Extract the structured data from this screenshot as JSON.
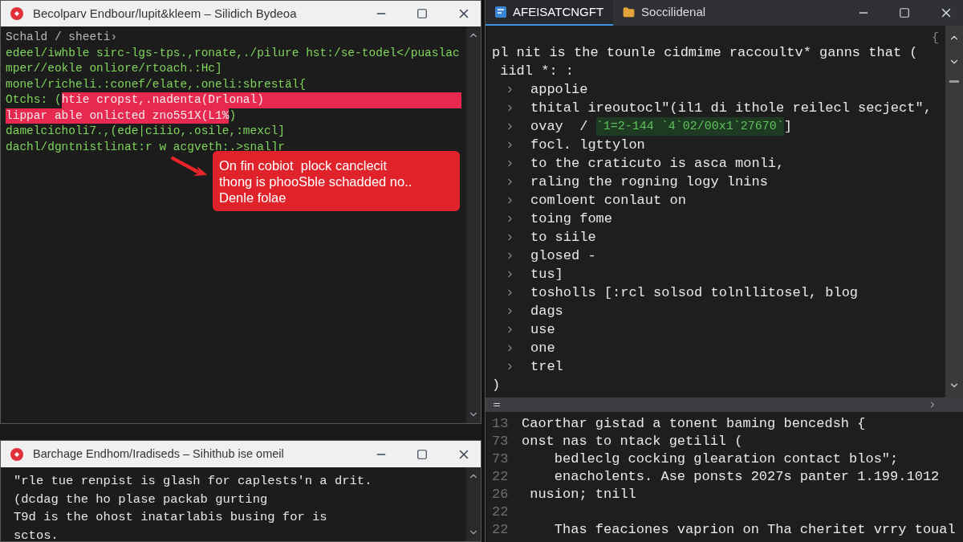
{
  "terminal_window": {
    "title": "Becolparv  Endbour/lupit&kleem – Silidich Bydeoa",
    "prompt": "Schald / sheeti›",
    "lines": [
      {
        "parts": [
          {
            "text": "edeel/iwhble sirc-lgs-tps.,ronate,./pilure hst:/se-todel</puaslac",
            "highlighted": false
          }
        ]
      },
      {
        "parts": [
          {
            "text": "mper//eokle onliore/rtoach.:Hc]",
            "highlighted": false
          }
        ]
      },
      {
        "parts": [
          {
            "text": "monel/richeli.:conef/elate,.oneli:sbrestäl{",
            "highlighted": false
          }
        ]
      },
      {
        "parts": [
          {
            "text": "Otchs: (",
            "highlighted": false
          },
          {
            "text": "htie cropst,.nadenta(Drlonal)",
            "highlighted": true
          }
        ]
      },
      {
        "parts": [
          {
            "text": "lippar able onlicted zno551X(L1%",
            "highlighted": true
          },
          {
            "text": ")",
            "highlighted": false
          }
        ]
      },
      {
        "parts": [
          {
            "text": "damelcicholi7.,(ede|ciiio,.osile,:mexcl]",
            "highlighted": false
          }
        ]
      },
      {
        "parts": [
          {
            "text": "dachl/dgntnistlinat:r w acgveth:.>snal]r",
            "highlighted": false
          }
        ]
      }
    ],
    "callout": {
      "lines": [
        "On fin cobiot  plock canclecit",
        "thong is phooSble schadded no..",
        "Denle folae"
      ]
    }
  },
  "notes_window": {
    "title": "Barchage  Endhom/Iradiseds – Sihithub ise omeil",
    "lines": [
      "\"rle tue renpist is glash for caplests'n a drit.",
      "(dcdag the ho plase packab gurting",
      "T9d is the ohost inatarlabis busing for is",
      "sctos."
    ]
  },
  "editor": {
    "tabs": [
      {
        "label": "AFEISATCNGFT",
        "selected": true,
        "kind": "code"
      },
      {
        "label": "Soccilidenal",
        "selected": false,
        "kind": "folder"
      }
    ],
    "corner_mark": "{",
    "intro_lines": [
      "pl nit is the tounle cidmime raccoultv* ganns that (",
      " iidl *: :"
    ],
    "items": [
      {
        "parts": [
          {
            "text": "appolie",
            "highlighted": false
          }
        ]
      },
      {
        "parts": [
          {
            "text": "thital ireoutocl\"(il1 di ithole reilecl secject\",",
            "highlighted": false
          }
        ]
      },
      {
        "parts": [
          {
            "text": "ovay  / ",
            "highlighted": false
          },
          {
            "text": "`1=2-144 `4`02/00x1`27670`",
            "highlighted": true
          },
          {
            "text": "]",
            "highlighted": false
          }
        ]
      },
      {
        "parts": [
          {
            "text": "focl. lgttylon",
            "highlighted": false
          }
        ]
      },
      {
        "parts": [
          {
            "text": "to the craticuto is asca monli,",
            "highlighted": false
          }
        ]
      },
      {
        "parts": [
          {
            "text": "raling the rogning logy lnins",
            "highlighted": false
          }
        ]
      },
      {
        "parts": [
          {
            "text": "comloent conlaut on",
            "highlighted": false
          }
        ]
      },
      {
        "parts": [
          {
            "text": "toing fome",
            "highlighted": false
          }
        ]
      },
      {
        "parts": [
          {
            "text": "to siile",
            "highlighted": false
          }
        ]
      },
      {
        "parts": [
          {
            "text": "glosed -",
            "highlighted": false
          }
        ]
      },
      {
        "parts": [
          {
            "text": "tus]",
            "highlighted": false
          }
        ]
      },
      {
        "parts": [
          {
            "text": "tosholls [:rcl solsod tolnllitosel, blog",
            "highlighted": false
          }
        ]
      },
      {
        "parts": [
          {
            "text": "dags",
            "highlighted": false
          }
        ]
      },
      {
        "parts": [
          {
            "text": "use",
            "highlighted": false
          }
        ]
      },
      {
        "parts": [
          {
            "text": "one",
            "highlighted": false
          }
        ]
      },
      {
        "parts": [
          {
            "text": "trel",
            "highlighted": false
          }
        ]
      }
    ],
    "closing": ")"
  },
  "panel": {
    "lines": [
      {
        "number": "13",
        "text": "Caorthar gistad a tonent baming bencedsh {"
      },
      {
        "number": "73",
        "text": "onst nas to ntack getilil ("
      },
      {
        "number": "73",
        "text": "    bedleclg cocking glearation contact blos\";"
      },
      {
        "number": "22",
        "text": "    enacholents. Ase ponsts 2027s panter 1.199.1012"
      },
      {
        "number": "26",
        "text": " nusion; tnill"
      },
      {
        "number": "22"
      },
      {
        "number": "22",
        "text": "    Thas feaciones vaprion on Tha cheritet vrry toual"
      }
    ]
  }
}
